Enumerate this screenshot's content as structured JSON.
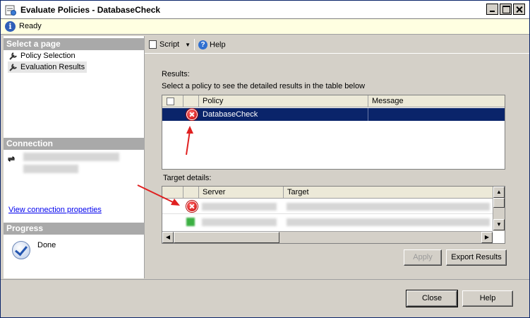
{
  "window": {
    "title": "Evaluate Policies - DatabaseCheck"
  },
  "status": {
    "text": "Ready"
  },
  "left": {
    "select_page_heading": "Select a page",
    "pages": [
      {
        "label": "Policy Selection"
      },
      {
        "label": "Evaluation Results"
      }
    ],
    "connection_heading": "Connection",
    "view_connection_link": "View connection properties",
    "progress_heading": "Progress",
    "progress_status": "Done"
  },
  "toolbar": {
    "script_label": "Script",
    "help_label": "Help"
  },
  "results": {
    "label": "Results:",
    "instruction": "Select a policy to see the detailed results in the table below",
    "columns": [
      "Policy",
      "Message"
    ],
    "rows": [
      {
        "policy": "DatabaseCheck",
        "message": ""
      }
    ]
  },
  "target_details": {
    "label": "Target details:",
    "columns": [
      "Server",
      "Target"
    ]
  },
  "buttons": {
    "apply": "Apply",
    "export": "Export Results",
    "close": "Close",
    "help": "Help"
  },
  "colors": {
    "selection": "#0a246a",
    "error": "#c80000",
    "annotation_arrow": "#e02020"
  },
  "icons": [
    "policy-icon",
    "info-icon",
    "wrench-icon",
    "connection-icon",
    "checkmark-icon",
    "script-icon",
    "help-icon",
    "error-icon"
  ]
}
